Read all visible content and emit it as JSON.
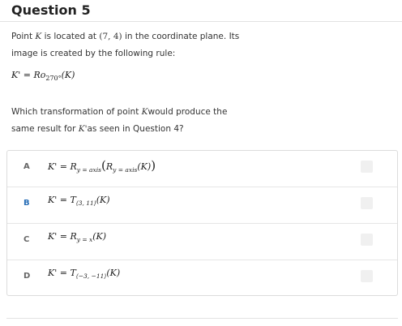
{
  "header": {
    "title": "Question 5"
  },
  "prompt": {
    "line1_pre": "Point ",
    "point": "K",
    "line1_mid": " is located at ",
    "coords": "(7, 4)",
    "line1_post": " in the coordinate plane. Its",
    "line2": "image is created by the following rule:"
  },
  "rule": {
    "lhs": "K' = Ro",
    "sub": "270°",
    "rhs": "(K)"
  },
  "question": {
    "line1_pre": "Which transformation of point ",
    "point": "K",
    "line1_post": "would produce the",
    "line2_pre": "same result for ",
    "kprime": "K'",
    "line2_post": "as seen in Question 4?"
  },
  "options": [
    {
      "letter": "A",
      "lhs": "K' = R",
      "sub1": "y = axis",
      "inner": "R",
      "sub2": "y = axis",
      "arg": "(K)"
    },
    {
      "letter": "B",
      "lhs": "K' = T",
      "sub1": "⟨3, 11⟩",
      "arg": "(K)"
    },
    {
      "letter": "C",
      "lhs": "K' = R",
      "sub1": "y = x",
      "arg": "(K)"
    },
    {
      "letter": "D",
      "lhs": "K' = T",
      "sub1": "⟨−3, −11⟩",
      "arg": "(K)"
    }
  ]
}
